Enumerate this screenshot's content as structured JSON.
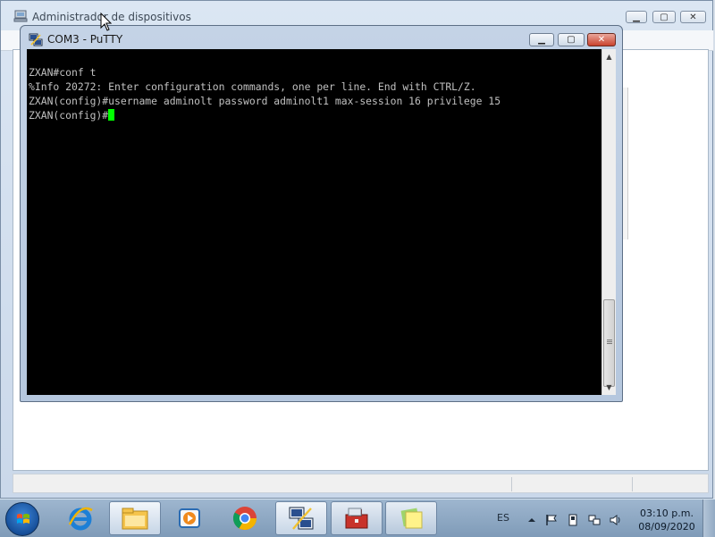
{
  "background_window": {
    "title": "Administrador de dispositivos"
  },
  "putty": {
    "title": "COM3 - PuTTY",
    "terminal_lines": [
      "ZXAN#conf t",
      "%Info 20272: Enter configuration commands, one per line. End with CTRL/Z.",
      "ZXAN(config)#username adminolt password adminolt1 max-session 16 privilege 15",
      "ZXAN(config)#"
    ]
  },
  "taskbar": {
    "language": "ES",
    "time": "03:10 p.m.",
    "date": "08/09/2020"
  },
  "colors": {
    "terminal_bg": "#000000",
    "terminal_text": "#c0c0c0",
    "cursor": "#00ff00"
  },
  "icons": [
    "device-manager-icon",
    "putty-icon",
    "windows-start-icon",
    "internet-explorer-icon",
    "file-explorer-icon",
    "media-player-icon",
    "chrome-icon",
    "putty-taskbar-icon",
    "toolbox-icon",
    "sticky-notes-icon",
    "flag-icon",
    "network-icon",
    "volume-icon"
  ]
}
